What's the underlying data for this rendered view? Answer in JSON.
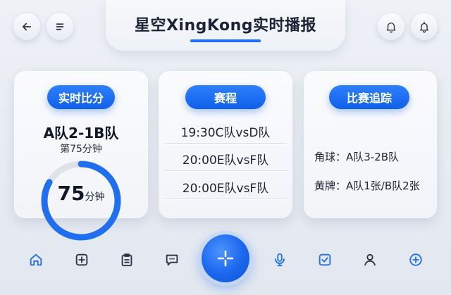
{
  "header": {
    "title": "星空XingKong实时播报",
    "back_icon": "arrow-left-icon",
    "menu_icon": "menu-lines-icon",
    "notification_icon": "bell-icon",
    "alert_icon": "bell-outline-icon"
  },
  "colors": {
    "accent": "#1f6ff2",
    "pill": "#1a6cf2",
    "ring_track": "#dfe2e8"
  },
  "cards": {
    "live_score": {
      "label": "实时比分",
      "match": "A队2-1B队",
      "minute_text": "第75分钟",
      "progress_value": "75",
      "progress_unit": "分钟",
      "progress_fraction": 0.833
    },
    "schedule": {
      "label": "赛程",
      "items": [
        "19:30C队vsD队",
        "20:00E队vsF队",
        "20:00E队vsF队"
      ]
    },
    "tracking": {
      "label": "比赛追踪",
      "corners": "角球：A队3-2B队",
      "yellow_cards": "黄牌：A队1张/B队2张"
    }
  },
  "bottom_nav": {
    "items": [
      "home-icon",
      "add-square-icon",
      "clipboard-icon",
      "chat-icon",
      "center-plus-icon",
      "microphone-icon",
      "checkbox-icon",
      "user-icon",
      "add-circle-icon"
    ]
  }
}
